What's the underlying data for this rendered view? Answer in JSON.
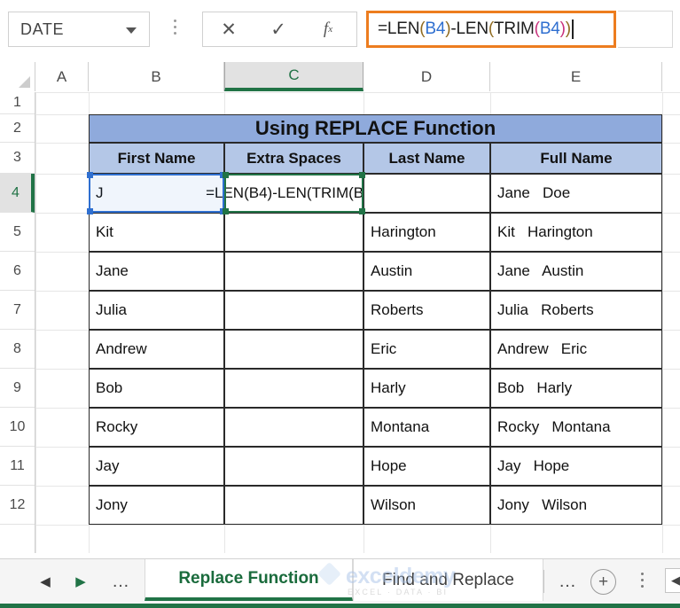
{
  "formula_bar": {
    "name_box_value": "DATE",
    "name_box_caret_icon": "chevron-down-icon",
    "cancel_label": "✕",
    "confirm_label": "✓",
    "fx_label": "f",
    "fx_sub": "x",
    "formula_text": "=LEN(B4)-LEN(TRIM(B4))",
    "formula_tokens": [
      {
        "text": "=LEN",
        "cls": "t-plain"
      },
      {
        "text": "(",
        "cls": "t-p1"
      },
      {
        "text": "B4",
        "cls": "t-blue"
      },
      {
        "text": ")",
        "cls": "t-p1"
      },
      {
        "text": "-LEN",
        "cls": "t-plain"
      },
      {
        "text": "(",
        "cls": "t-p1"
      },
      {
        "text": "TRIM",
        "cls": "t-plain"
      },
      {
        "text": "(",
        "cls": "t-p3"
      },
      {
        "text": "B4",
        "cls": "t-blue"
      },
      {
        "text": ")",
        "cls": "t-p3"
      },
      {
        "text": ")",
        "cls": "t-p1"
      }
    ],
    "highlight_color": "#ed7d1f"
  },
  "grid": {
    "columns": [
      "A",
      "B",
      "C",
      "D",
      "E"
    ],
    "selected_column": "C",
    "rows": [
      "1",
      "2",
      "3",
      "4",
      "5",
      "6",
      "7",
      "8",
      "9",
      "10",
      "11",
      "12"
    ],
    "selected_row": "4",
    "accent_color": "#217346"
  },
  "table": {
    "title": "Using REPLACE Function",
    "title_bg": "#8faadc",
    "header_bg": "#b4c7e7",
    "headers": [
      "First Name",
      "Extra Spaces",
      "Last Name",
      "Full Name"
    ],
    "rows": [
      {
        "first": "J",
        "extra": "=LEN(B4)-LEN(TRIM(B4))",
        "last": "",
        "full": "Jane   Doe"
      },
      {
        "first": "Kit",
        "extra": "",
        "last": "Harington",
        "full": "Kit   Harington"
      },
      {
        "first": "Jane",
        "extra": "",
        "last": "Austin",
        "full": "Jane   Austin"
      },
      {
        "first": "Julia",
        "extra": "",
        "last": "Roberts",
        "full": "Julia   Roberts"
      },
      {
        "first": "Andrew",
        "extra": "",
        "last": "Eric",
        "full": "Andrew   Eric"
      },
      {
        "first": "Bob",
        "extra": "",
        "last": "Harly",
        "full": "Bob   Harly"
      },
      {
        "first": "Rocky",
        "extra": "",
        "last": "Montana",
        "full": "Rocky   Montana"
      },
      {
        "first": "Jay",
        "extra": "",
        "last": "Hope",
        "full": "Jay   Hope"
      },
      {
        "first": "Jony",
        "extra": "",
        "last": "Wilson",
        "full": "Jony   Wilson"
      }
    ]
  },
  "tabbar": {
    "prev_icon": "◀",
    "next_icon": "▶",
    "ellipsis_left": "…",
    "ellipsis_right": "…",
    "tabs": [
      {
        "label": "Replace Function",
        "active": true
      },
      {
        "label": "Find and Replace",
        "active": false
      }
    ],
    "add_sheet_label": "+",
    "scroll_left_icon": "◀"
  },
  "watermark": {
    "name": "exceldemy",
    "subtitle": "EXCEL · DATA · BI"
  }
}
